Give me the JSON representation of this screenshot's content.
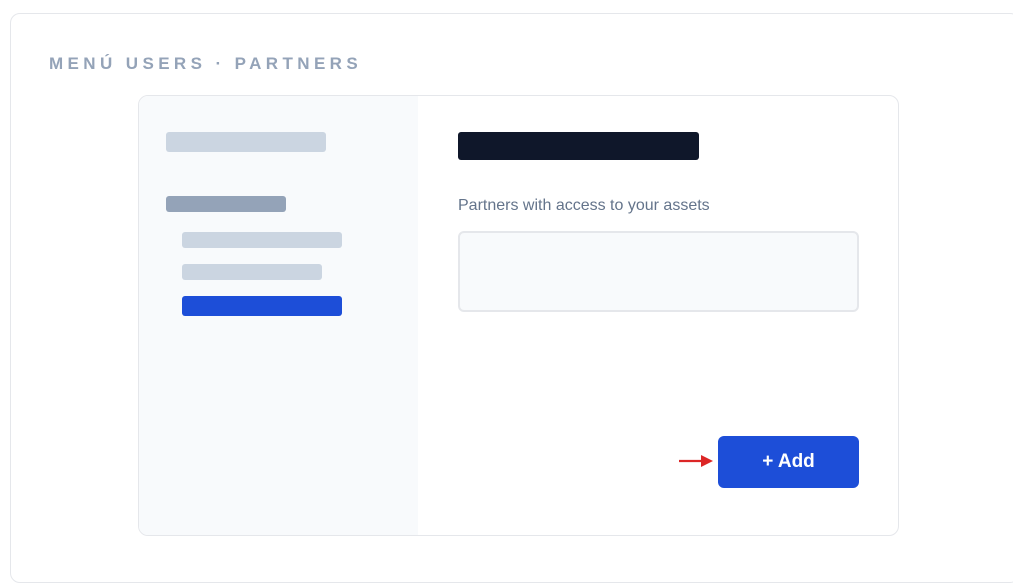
{
  "caption": "MENÚ USERS · PARTNERS",
  "main": {
    "section_label": "Partners with access to your assets",
    "add_button_label": "+ Add"
  },
  "annotation": {
    "arrow_icon": "right-arrow-icon",
    "arrow_color": "#dc2626"
  },
  "colors": {
    "accent": "#1d4ed8",
    "title_bar": "#0f172a",
    "placeholder": "#cbd5e1",
    "placeholder_dark": "#94a3b8"
  }
}
